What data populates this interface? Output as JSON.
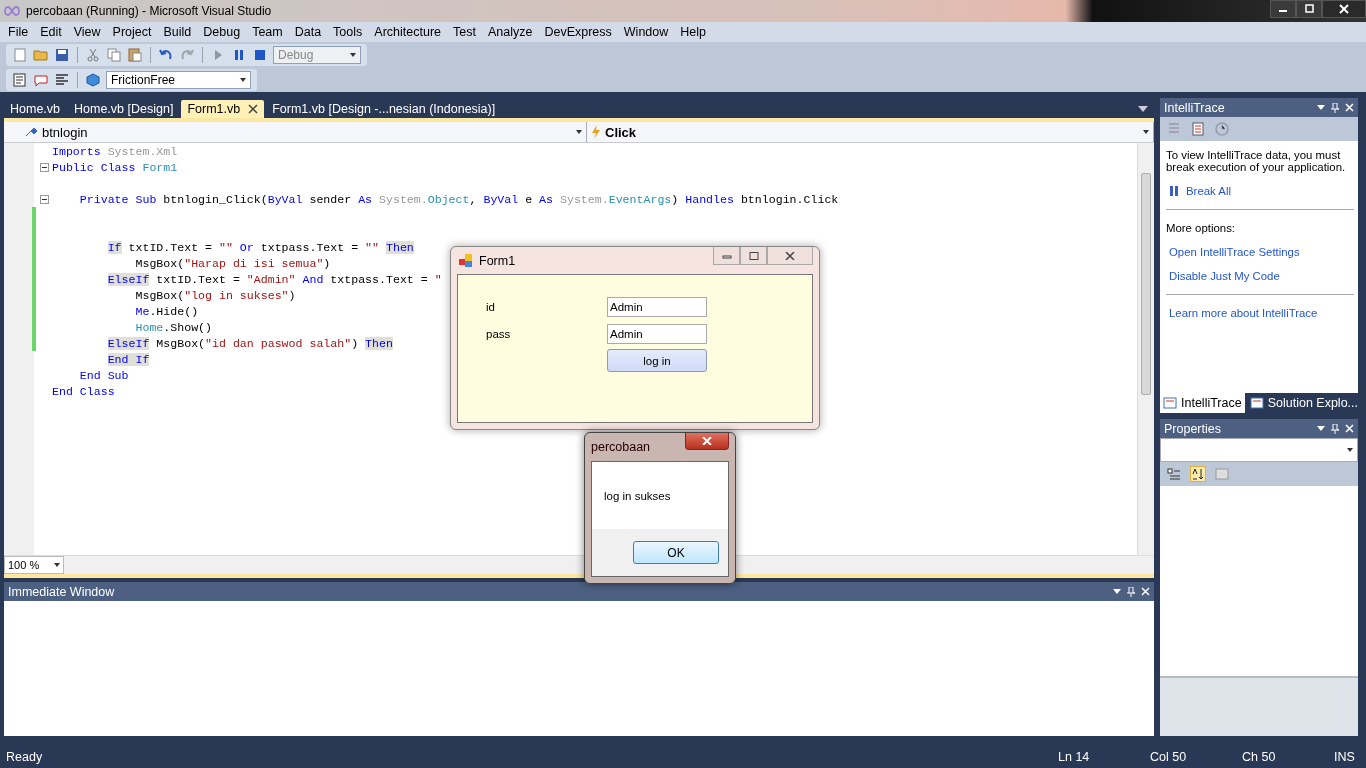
{
  "window": {
    "title": "percobaan (Running) - Microsoft Visual Studio"
  },
  "menu": [
    "File",
    "Edit",
    "View",
    "Project",
    "Build",
    "Debug",
    "Team",
    "Data",
    "Tools",
    "Architecture",
    "Test",
    "Analyze",
    "DevExpress",
    "Window",
    "Help"
  ],
  "toolbar": {
    "configuration": "Debug",
    "style_combo": "FrictionFree"
  },
  "document_tabs": [
    {
      "label": "Home.vb",
      "selected": false
    },
    {
      "label": "Home.vb [Design]",
      "selected": false
    },
    {
      "label": "Form1.vb",
      "selected": true
    },
    {
      "label": "Form1.vb [Design -...nesian (Indonesia)]",
      "selected": false
    }
  ],
  "editor": {
    "object_combo": "btnlogin",
    "event_combo": "Click",
    "zoom": "100 %",
    "lines": [
      {
        "changed": false,
        "collapsible": false,
        "tokens": [
          {
            "kind": "keyword",
            "text": "Imports"
          },
          {
            "kind": "muted",
            "text": " System.Xml"
          }
        ]
      },
      {
        "changed": false,
        "collapsible": true,
        "tokens": [
          {
            "kind": "keyword",
            "text": "Public Class"
          },
          {
            "kind": "type",
            "text": " Form1"
          }
        ],
        "children": [
          {
            "changed": false,
            "collapsible": false
          },
          {
            "changed": false,
            "collapsible": true,
            "tokens": [
              {
                "kind": "keyword",
                "text": "Private Sub"
              },
              {
                "kind": "plain",
                "text": " btnlogin_Click("
              },
              {
                "kind": "keyword",
                "text": "ByVal"
              },
              {
                "kind": "plain",
                "text": " sender "
              },
              {
                "kind": "keyword",
                "text": "As"
              },
              {
                "kind": "muted",
                "text": " System."
              },
              {
                "kind": "type",
                "text": "Object"
              },
              {
                "kind": "plain",
                "text": ", "
              },
              {
                "kind": "keyword",
                "text": "ByVal"
              },
              {
                "kind": "plain",
                "text": " e "
              },
              {
                "kind": "keyword",
                "text": "As"
              },
              {
                "kind": "muted",
                "text": " System."
              },
              {
                "kind": "type",
                "text": "EventArgs"
              },
              {
                "kind": "plain",
                "text": ") "
              },
              {
                "kind": "keyword",
                "text": "Handles"
              },
              {
                "kind": "plain",
                "text": " btnlogin.Click"
              }
            ],
            "children": [
              {
                "changed": true,
                "collapsible": false
              },
              {
                "changed": true,
                "collapsible": false
              },
              {
                "changed": true,
                "collapsible": false,
                "tokens": [
                  {
                    "kind": "highlighted",
                    "text": "If"
                  },
                  {
                    "kind": "plain",
                    "text": " txtID.Text = "
                  },
                  {
                    "kind": "string",
                    "text": "\"\""
                  },
                  {
                    "kind": "keyword",
                    "text": " Or"
                  },
                  {
                    "kind": "plain",
                    "text": " txtpass.Text = "
                  },
                  {
                    "kind": "string",
                    "text": "\"\" "
                  },
                  {
                    "kind": "highlighted",
                    "text": "Then"
                  }
                ],
                "children": [
                  {
                    "changed": true,
                    "collapsible": false,
                    "tokens": [
                      {
                        "kind": "plain",
                        "text": "MsgBox("
                      },
                      {
                        "kind": "string",
                        "text": "\"Harap di isi semua\""
                      },
                      {
                        "kind": "plain",
                        "text": ")"
                      }
                    ]
                  }
                ]
              },
              {
                "changed": true,
                "collapsible": false,
                "tokens": [
                  {
                    "kind": "highlighted",
                    "text": "ElseIf"
                  },
                  {
                    "kind": "plain",
                    "text": " txtID.Text = "
                  },
                  {
                    "kind": "string",
                    "text": "\"Admin\""
                  },
                  {
                    "kind": "keyword",
                    "text": " And"
                  },
                  {
                    "kind": "plain",
                    "text": " txtpass.Text = "
                  },
                  {
                    "kind": "string",
                    "text": "\""
                  }
                ],
                "children": [
                  {
                    "changed": true,
                    "collapsible": false,
                    "tokens": [
                      {
                        "kind": "plain",
                        "text": "MsgBox("
                      },
                      {
                        "kind": "string",
                        "text": "\"log in sukses\""
                      },
                      {
                        "kind": "plain",
                        "text": ")"
                      }
                    ]
                  },
                  {
                    "changed": true,
                    "collapsible": false,
                    "tokens": [
                      {
                        "kind": "keyword",
                        "text": "Me"
                      },
                      {
                        "kind": "plain",
                        "text": ".Hide()"
                      }
                    ]
                  },
                  {
                    "changed": true,
                    "collapsible": false,
                    "tokens": [
                      {
                        "kind": "type",
                        "text": "Home"
                      },
                      {
                        "kind": "plain",
                        "text": ".Show()"
                      }
                    ]
                  }
                ]
              },
              {
                "changed": true,
                "collapsible": false,
                "tokens": [
                  {
                    "kind": "highlighted",
                    "text": "ElseIf"
                  },
                  {
                    "kind": "plain",
                    "text": " MsgBox("
                  },
                  {
                    "kind": "string",
                    "text": "\"id dan paswod salah\""
                  },
                  {
                    "kind": "plain",
                    "text": ") "
                  },
                  {
                    "kind": "highlighted",
                    "text": "Then"
                  }
                ]
              },
              {
                "changed": false,
                "collapsible": false,
                "tokens": [
                  {
                    "kind": "highlighted",
                    "text": "End If"
                  }
                ]
              }
            ]
          },
          {
            "changed": false,
            "collapsible": false,
            "tokens": [
              {
                "kind": "keyword",
                "text": "End Sub"
              }
            ]
          }
        ]
      },
      {
        "changed": false,
        "collapsible": false,
        "tokens": [
          {
            "kind": "keyword",
            "text": "End Class"
          }
        ]
      }
    ]
  },
  "intellitrace": {
    "title": "IntelliTrace",
    "message": "To view IntelliTrace data, you must break execution of your application.",
    "break_link": "Break All",
    "more_heading": "More options:",
    "option_links": [
      "Open IntelliTrace Settings",
      "Disable Just My Code"
    ],
    "learn_link": "Learn more about IntelliTrace"
  },
  "side_tabs": [
    {
      "label": "IntelliTrace",
      "selected": true
    },
    {
      "label": "Solution Explo...",
      "selected": false
    }
  ],
  "properties": {
    "title": "Properties"
  },
  "immediate_window": {
    "title": "Immediate Window"
  },
  "form_window": {
    "title": "Form1",
    "fields": [
      {
        "label": "id",
        "value": "Admin"
      },
      {
        "label": "pass",
        "value": "Admin"
      }
    ],
    "button": "log in"
  },
  "message_box": {
    "title": "percobaan",
    "message": "log in sukses",
    "button": "OK"
  },
  "status_bar": {
    "message": "Ready",
    "line": "Ln 14",
    "column": "Col 50",
    "char": "Ch 50",
    "mode": "INS"
  }
}
